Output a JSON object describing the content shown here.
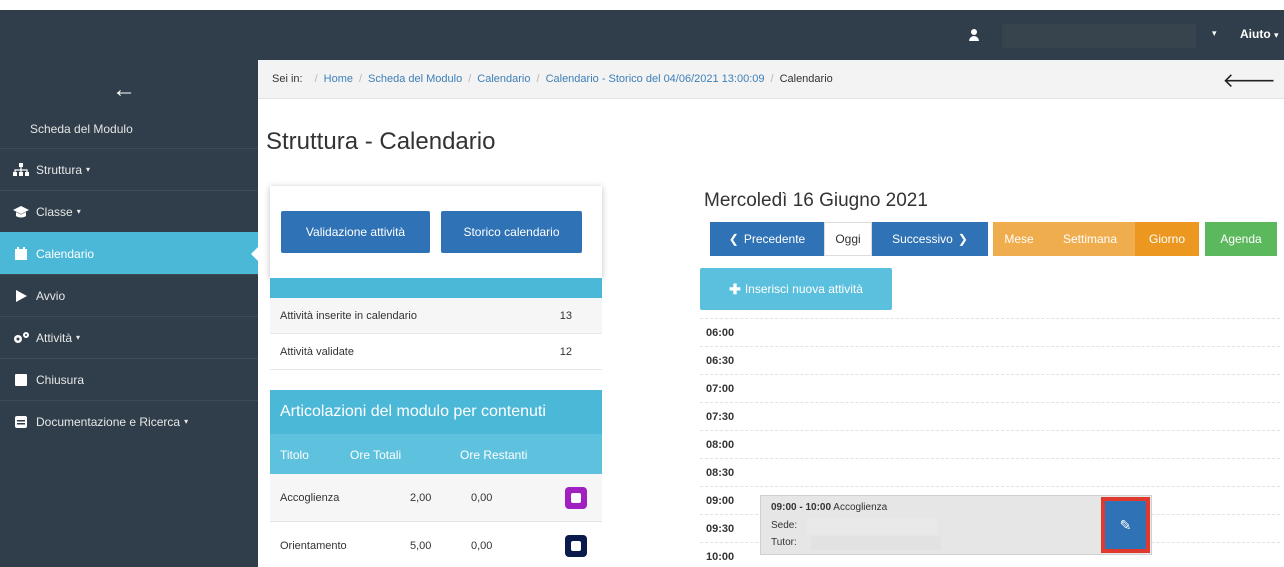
{
  "topbar": {
    "user_name": "",
    "help_label": "Aiuto"
  },
  "sidebar": {
    "title": "Scheda del Modulo",
    "items": [
      {
        "label": "Struttura",
        "icon": "sitemap-icon",
        "has_caret": true
      },
      {
        "label": "Classe",
        "icon": "graduation-cap-icon",
        "has_caret": true
      },
      {
        "label": "Calendario",
        "icon": "calendar-icon",
        "active": true
      },
      {
        "label": "Avvio",
        "icon": "play-icon"
      },
      {
        "label": "Attività",
        "icon": "gears-icon",
        "has_caret": true
      },
      {
        "label": "Chiusura",
        "icon": "square-icon"
      },
      {
        "label": "Documentazione e Ricerca",
        "icon": "square-lines-icon",
        "has_caret": true
      }
    ]
  },
  "breadcrumb": {
    "prefix": "Sei in:",
    "links": [
      "Home",
      "Scheda del Modulo",
      "Calendario",
      "Calendario - Storico del 04/06/2021 13:00:09"
    ],
    "current": "Calendario"
  },
  "page": {
    "title": "Struttura - Calendario"
  },
  "actions": {
    "validate_label": "Validazione attività",
    "history_label": "Storico calendario"
  },
  "stats": [
    {
      "label": "Attività inserite in calendario",
      "value": "13"
    },
    {
      "label": "Attività validate",
      "value": "12"
    }
  ],
  "articolazioni": {
    "title": "Articolazioni del modulo per contenuti",
    "columns": [
      "Titolo",
      "Ore Totali",
      "Ore Restanti"
    ],
    "rows": [
      {
        "title": "Accoglienza",
        "total": "2,00",
        "remaining": "0,00",
        "color": "#a020c0"
      },
      {
        "title": "Orientamento",
        "total": "5,00",
        "remaining": "0,00",
        "color": "#0a1a4a"
      }
    ]
  },
  "calendar": {
    "date": "Mercoledì 16 Giugno 2021",
    "nav": {
      "prev": "Precedente",
      "today": "Oggi",
      "next": "Successivo"
    },
    "views": {
      "month": "Mese",
      "week": "Settimana",
      "day": "Giorno",
      "agenda": "Agenda"
    },
    "new_label": "Inserisci nuova attività",
    "slots": [
      "06:00",
      "06:30",
      "07:00",
      "07:30",
      "08:00",
      "08:30",
      "09:00",
      "09:30",
      "10:00"
    ],
    "event": {
      "time": "09:00 - 10:00",
      "title": "Accoglienza",
      "sede_label": "Sede:",
      "tutor_label": "Tutor:"
    }
  },
  "colors": {
    "sidebar_bg": "#2f3e4a",
    "accent_cyan": "#4cb8d8",
    "primary_blue": "#2f72b6",
    "warning_orange": "#f0ad4e",
    "active_orange": "#ec971f",
    "success_green": "#5cb85c",
    "highlight_red": "#e03a2f"
  }
}
